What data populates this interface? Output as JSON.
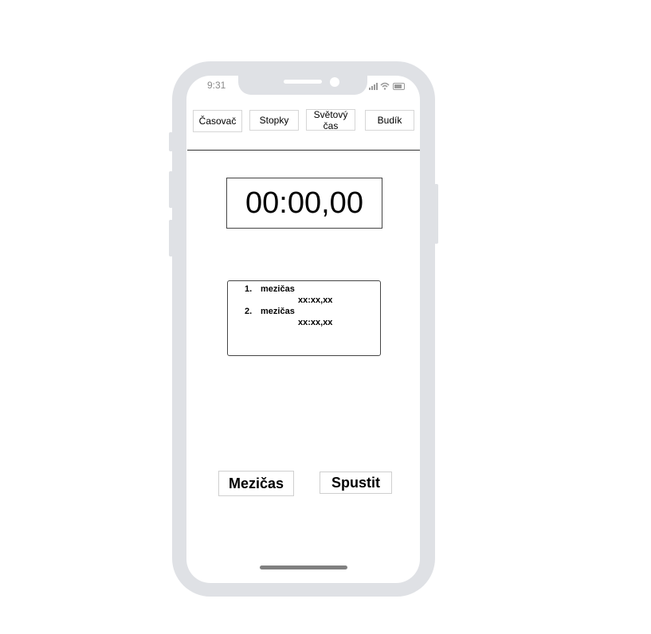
{
  "status_bar": {
    "time": "9:31"
  },
  "tabs": [
    {
      "label": "Časovač"
    },
    {
      "label": "Stopky"
    },
    {
      "label": "Světový čas"
    },
    {
      "label": "Budík"
    }
  ],
  "stopwatch": {
    "display": "00:00,00"
  },
  "laps": [
    {
      "number": "1.",
      "label": "mezičas",
      "time": "xx:xx,xx"
    },
    {
      "number": "2.",
      "label": "mezičas",
      "time": "xx:xx,xx"
    }
  ],
  "actions": {
    "lap_label": "Mezičas",
    "start_label": "Spustit"
  },
  "colors": {
    "frame": "#dfe1e5",
    "screen": "#ffffff",
    "home_indicator": "#808080"
  }
}
